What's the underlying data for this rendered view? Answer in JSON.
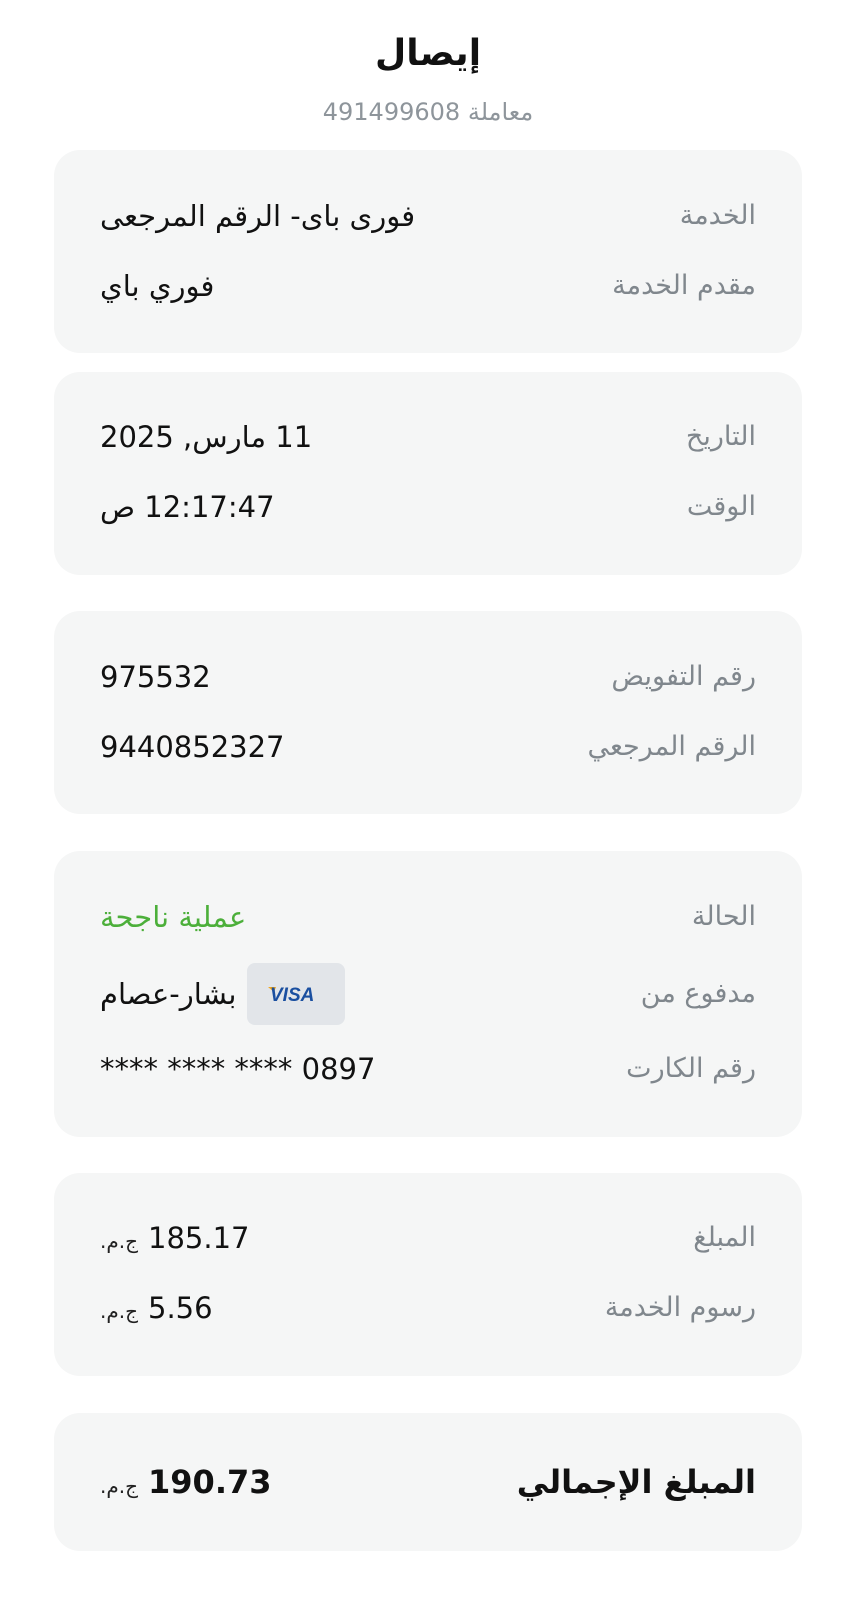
{
  "header": {
    "title": "إيصال",
    "transaction_label": "معاملة",
    "transaction_number": "491499608"
  },
  "service_card": {
    "service_label": "الخدمة",
    "service_value": "فورى باى- الرقم المرجعى",
    "provider_label": "مقدم الخدمة",
    "provider_value": "فوري باي"
  },
  "datetime_card": {
    "date_label": "التاريخ",
    "date_value": "11 مارس, 2025",
    "time_label": "الوقت",
    "time_value": "12:17:47 ص"
  },
  "reference_card": {
    "auth_label": "رقم التفويض",
    "auth_value": "975532",
    "ref_label": "الرقم المرجعي",
    "ref_value": "9440852327"
  },
  "payment_card": {
    "status_label": "الحالة",
    "status_value": "عملية ناجحة",
    "status_color": "#4caf3a",
    "paid_from_label": "مدفوع من",
    "payer_name": "بشار-عصام",
    "card_brand": "VISA",
    "card_number_label": "رقم الكارت",
    "card_number_value": "**** **** **** 0897"
  },
  "amounts_card": {
    "amount_label": "المبلغ",
    "amount_value": "185.17",
    "amount_currency": "ج.م.",
    "fee_label": "رسوم الخدمة",
    "fee_value": "5.56",
    "fee_currency": "ج.م."
  },
  "total_card": {
    "total_label": "المبلغ الإجمالي",
    "total_value": "190.73",
    "total_currency": "ج.م."
  }
}
